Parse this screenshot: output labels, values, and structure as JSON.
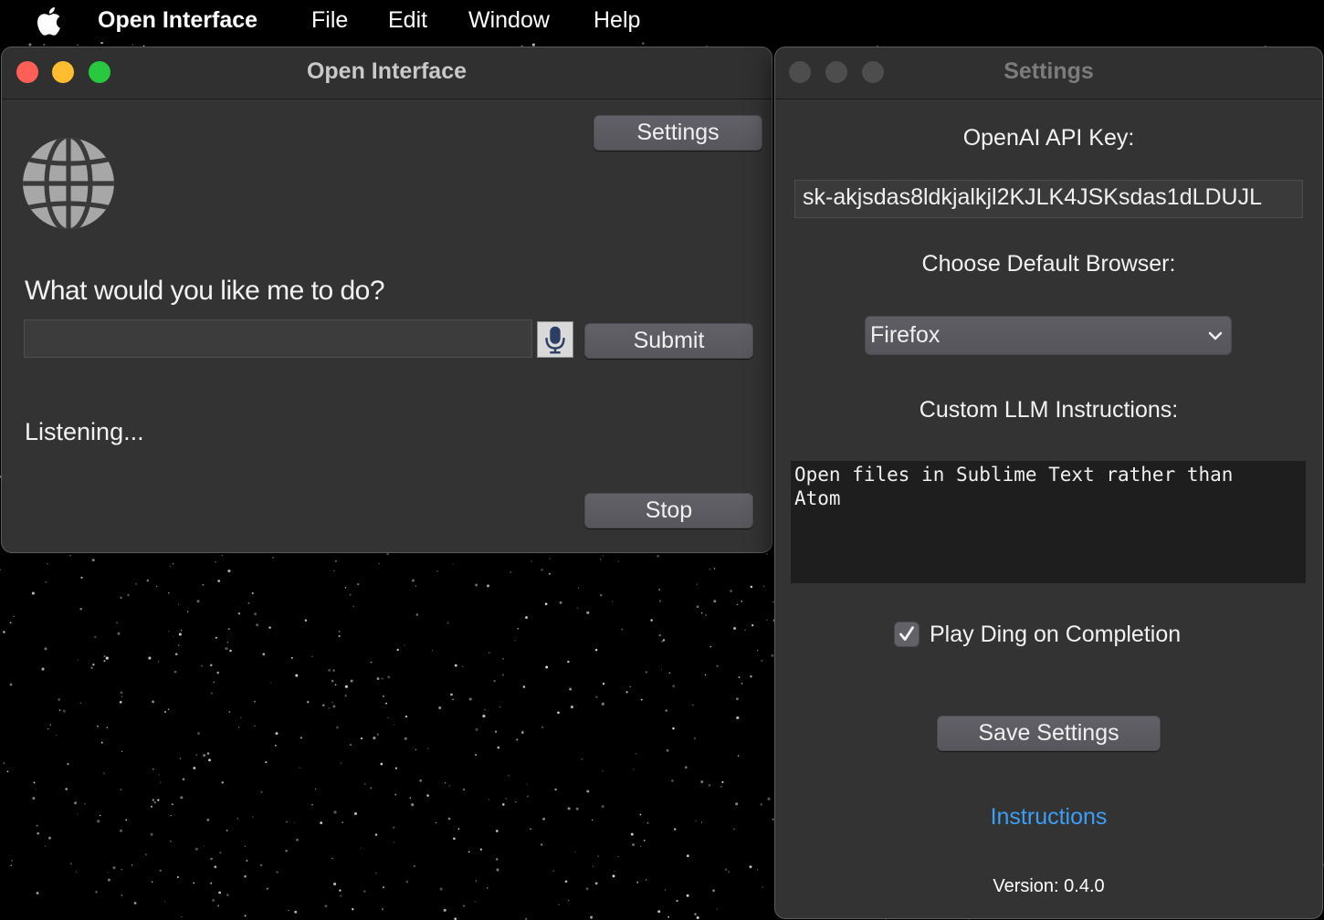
{
  "menubar": {
    "apple_icon": "apple-logo-icon",
    "app_name": "Open Interface",
    "items": [
      "File",
      "Edit",
      "Window",
      "Help"
    ]
  },
  "main_window": {
    "title": "Open Interface",
    "settings_button": "Settings",
    "logo_icon": "globe-icon",
    "prompt_label": "What would you like me to do?",
    "input_value": "",
    "mic_icon": "microphone-icon",
    "submit_button": "Submit",
    "status_text": "Listening...",
    "stop_button": "Stop"
  },
  "settings_window": {
    "title": "Settings",
    "api_key_label": "OpenAI API Key:",
    "api_key_value": "sk-akjsdas8ldkjalkjl2KJLK4JSKsdas1dLDUJL",
    "browser_label": "Choose Default Browser:",
    "browser_selected": "Firefox",
    "llm_label": "Custom LLM Instructions:",
    "llm_value": "Open files in Sublime Text rather than\nAtom",
    "ding_label": "Play Ding on Completion",
    "ding_checked": true,
    "save_button": "Save Settings",
    "instructions_link": "Instructions",
    "version_text": "Version: 0.4.0"
  },
  "colors": {
    "close": "#ff5f57",
    "minimize": "#febc2e",
    "zoom": "#28c840",
    "inactive_light": "#4d4d4d",
    "link": "#3b9ff6",
    "window_bg": "#333333",
    "button_bg": "#5e5d63"
  }
}
